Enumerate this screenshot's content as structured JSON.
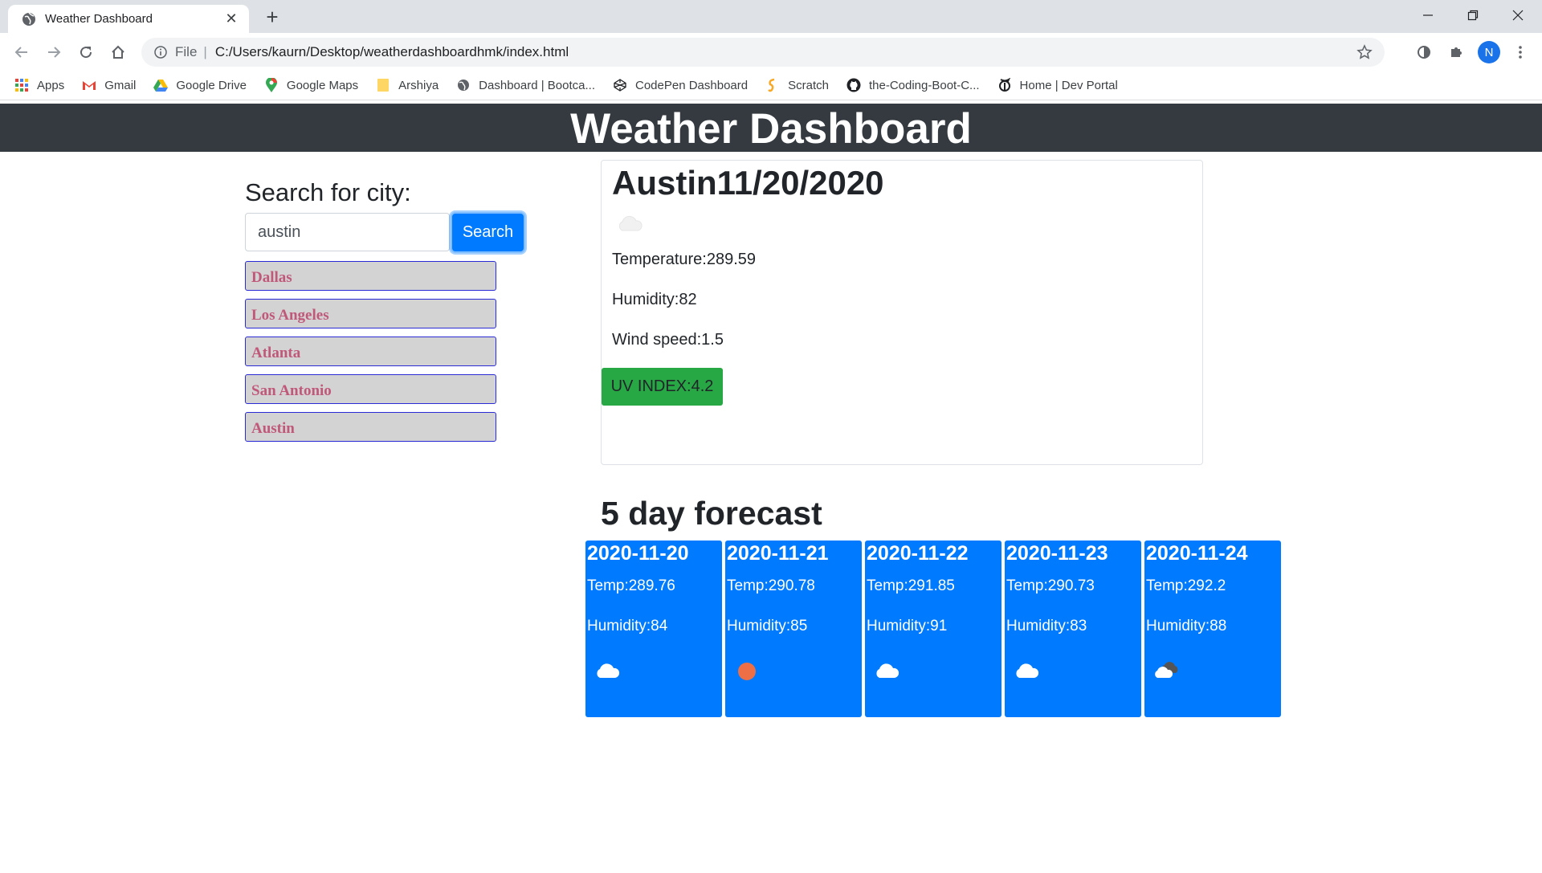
{
  "browser": {
    "tab_title": "Weather Dashboard",
    "new_tab_symbol": "+",
    "url_scheme": "File",
    "url": "C:/Users/kaurn/Desktop/weatherdashboardhmk/index.html",
    "profile_initial": "N",
    "bookmarks": [
      {
        "label": "Apps",
        "icon": "apps-grid-icon"
      },
      {
        "label": "Gmail",
        "icon": "gmail-icon"
      },
      {
        "label": "Google Drive",
        "icon": "google-drive-icon"
      },
      {
        "label": "Google Maps",
        "icon": "google-maps-icon"
      },
      {
        "label": "Arshiya",
        "icon": "folder-icon"
      },
      {
        "label": "Dashboard | Bootca...",
        "icon": "globe-icon"
      },
      {
        "label": "CodePen Dashboard",
        "icon": "codepen-icon"
      },
      {
        "label": "Scratch",
        "icon": "scratch-icon"
      },
      {
        "label": "the-Coding-Boot-C...",
        "icon": "github-icon"
      },
      {
        "label": "Home | Dev Portal",
        "icon": "nyt-icon"
      }
    ]
  },
  "header": {
    "title": "Weather Dashboard"
  },
  "search": {
    "title": "Search for city:",
    "input_value": "austin",
    "button_label": "Search"
  },
  "history": [
    "Dallas",
    "Los Angeles",
    "Atlanta",
    "San Antonio",
    "Austin"
  ],
  "current": {
    "heading": "Austin11/20/2020",
    "icon": "cloud-icon",
    "temperature": "Temperature:289.59",
    "humidity": "Humidity:82",
    "wind": "Wind speed:1.5",
    "uv": "UV INDEX:4.2",
    "uv_color": "#28a745"
  },
  "forecast": {
    "title": "5 day forecast",
    "card_color": "#007bff",
    "days": [
      {
        "date": "2020-11-20",
        "temp": "Temp:289.76",
        "humidity": "Humidity:84",
        "icon": "cloud-icon"
      },
      {
        "date": "2020-11-21",
        "temp": "Temp:290.78",
        "humidity": "Humidity:85",
        "icon": "sun-icon"
      },
      {
        "date": "2020-11-22",
        "temp": "Temp:291.85",
        "humidity": "Humidity:91",
        "icon": "cloud-icon"
      },
      {
        "date": "2020-11-23",
        "temp": "Temp:290.73",
        "humidity": "Humidity:83",
        "icon": "cloud-icon"
      },
      {
        "date": "2020-11-24",
        "temp": "Temp:292.2",
        "humidity": "Humidity:88",
        "icon": "broken-clouds-icon"
      }
    ]
  }
}
